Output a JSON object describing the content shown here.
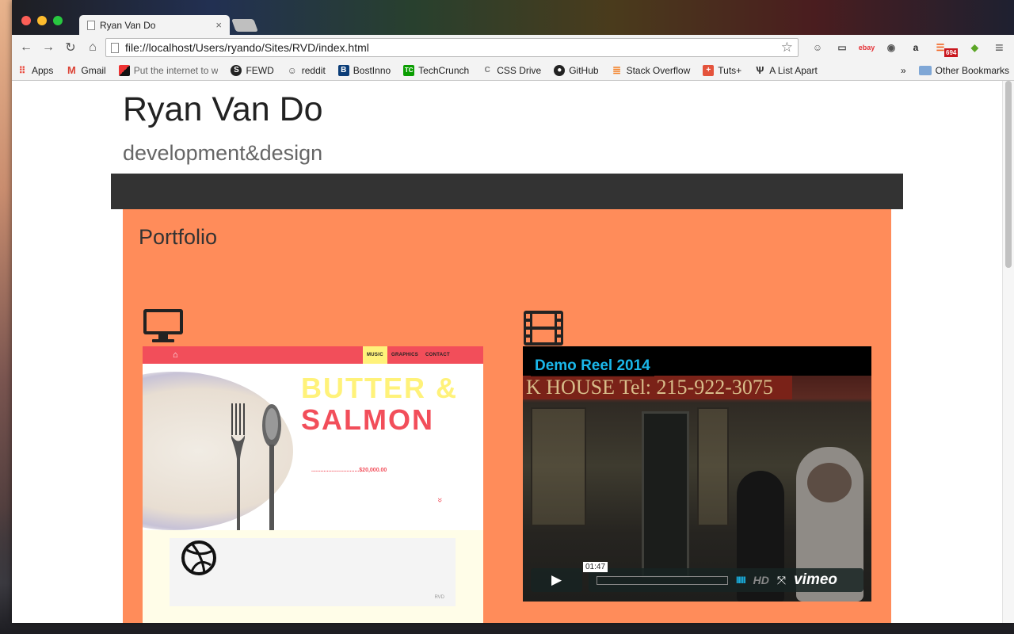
{
  "browser": {
    "tab_title": "Ryan Van Do",
    "tab_close": "×",
    "url": "file://localhost/Users/ryando/Sites/RVD/index.html",
    "nav": {
      "back": "←",
      "forward": "→",
      "reload": "↻",
      "home": "⌂",
      "star": "☆",
      "menu": "≡"
    },
    "extensions": [
      "ebay",
      "a",
      "694"
    ]
  },
  "bookmarks": {
    "items": [
      {
        "label": "Apps",
        "icon": "apps-grid-icon",
        "color": "#e94235"
      },
      {
        "label": "Gmail",
        "icon": "gmail-icon",
        "color": "#db4437"
      },
      {
        "label": "Put the internet to w",
        "icon": "pointer-icon",
        "color": "#1a1a1a"
      },
      {
        "label": "FEWD",
        "icon": "fewd-icon",
        "color": "#222222"
      },
      {
        "label": "reddit",
        "icon": "reddit-icon",
        "color": "#555555"
      },
      {
        "label": "BostInno",
        "icon": "bostinno-icon",
        "color": "#0b3d78"
      },
      {
        "label": "TechCrunch",
        "icon": "techcrunch-icon",
        "color": "#0a9e01"
      },
      {
        "label": "CSS Drive",
        "icon": "cssdrive-icon",
        "color": "#777777"
      },
      {
        "label": "GitHub",
        "icon": "github-icon",
        "color": "#222222"
      },
      {
        "label": "Stack Overflow",
        "icon": "stackoverflow-icon",
        "color": "#f48024"
      },
      {
        "label": "Tuts+",
        "icon": "tuts-icon",
        "color": "#e4533c"
      },
      {
        "label": "A List Apart",
        "icon": "alistapart-icon",
        "color": "#333333"
      }
    ],
    "overflow": "»",
    "other": "Other Bookmarks"
  },
  "site": {
    "title": "Ryan Van Do",
    "subtitle": "development&design",
    "portfolio_heading": "Portfolio"
  },
  "web_project": {
    "nav_music": "MUSIC",
    "nav_graphics": "GRAPHICS",
    "nav_contact": "CONTACT",
    "headline_1": "BUTTER &",
    "headline_2": "SALMON",
    "price": "...............................$20,000.00",
    "chevron": "»",
    "mark": "RVD"
  },
  "video": {
    "title": "Demo Reel 2014",
    "sign_text": "K HOUSE   Tel: 215-922-3075",
    "timecode": "01:47",
    "play": "▶",
    "volume": "IIIII",
    "hd": "HD",
    "fullscreen": "⤧",
    "brand": "vimeo"
  }
}
